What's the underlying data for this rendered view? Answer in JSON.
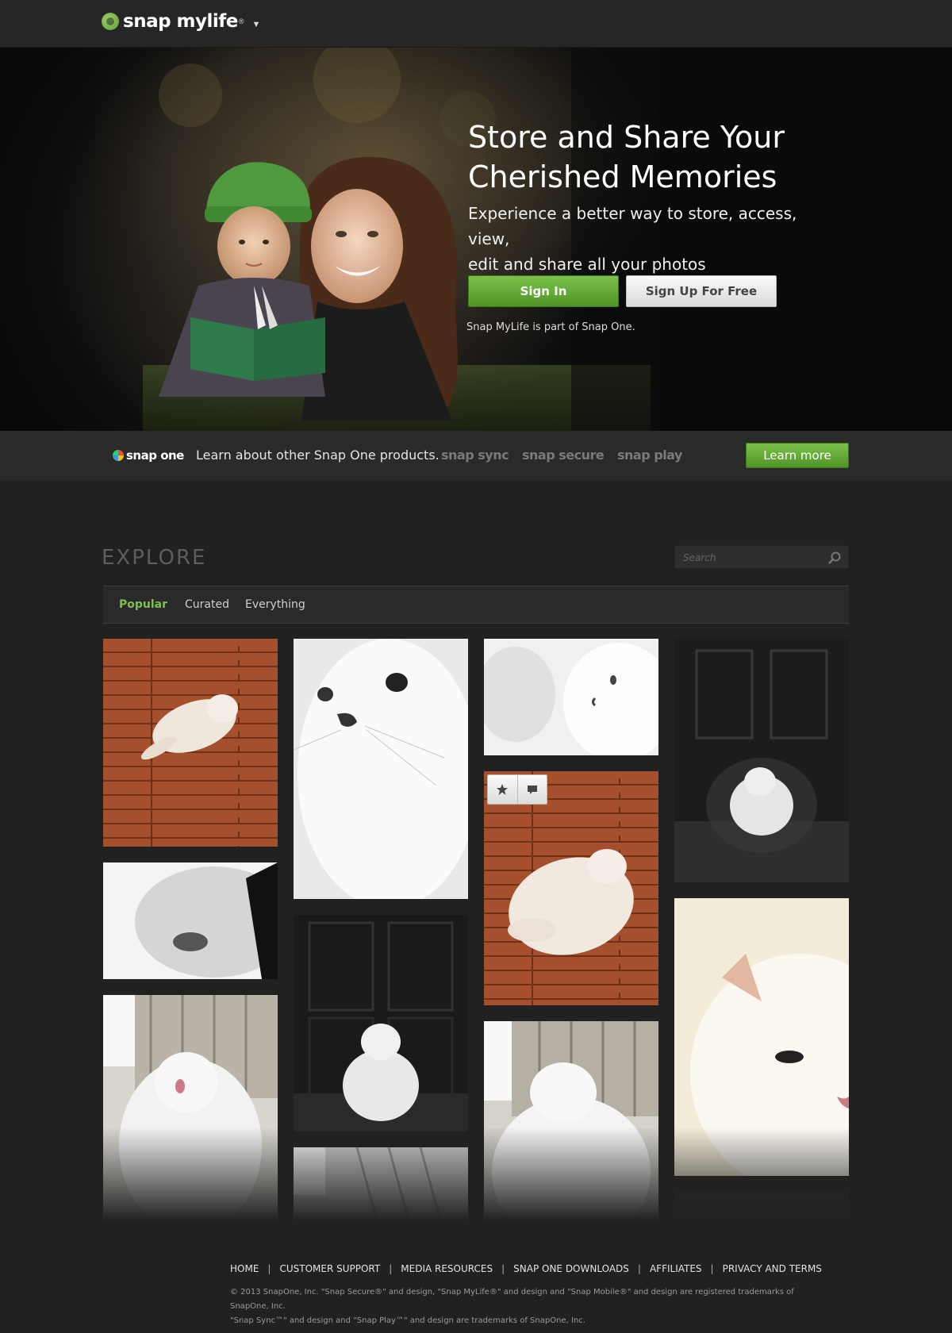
{
  "header": {
    "logo_text": "snap mylife",
    "logo_reg": "®",
    "menu_caret": "▼"
  },
  "hero": {
    "title_line1": "Store and Share Your",
    "title_line2": "Cherished Memories",
    "subtitle_line1": "Experience a better way to store, access, view,",
    "subtitle_line2": "edit and share all your photos",
    "signin_label": "Sign In",
    "signup_label": "Sign Up For Free",
    "note": "Snap MyLife is part of Snap One."
  },
  "snapone": {
    "logo_text": "snap one",
    "blurb": "Learn about other Snap One products.",
    "products": [
      "snap sync",
      "snap secure",
      "snap play"
    ],
    "learn_more_label": "Learn more"
  },
  "explore": {
    "title": "EXPLORE",
    "search_placeholder": "Search",
    "tabs": [
      {
        "label": "Popular",
        "active": true
      },
      {
        "label": "Curated",
        "active": false
      },
      {
        "label": "Everything",
        "active": false
      }
    ]
  },
  "footer": {
    "links": [
      "HOME",
      "CUSTOMER SUPPORT",
      "MEDIA RESOURCES",
      "SNAP ONE DOWNLOADS",
      "AFFILIATES",
      "PRIVACY AND TERMS"
    ],
    "separator": "|",
    "copyright_line1": "© 2013 SnapOne, Inc. \"Snap Secure®\" and design, \"Snap MyLife®\" and design and \"Snap Mobile®\" and design are registered trademarks of SnapOne, Inc.",
    "copyright_line2": "\"Snap Sync™\" and design and \"Snap Play™\" and design are trademarks of SnapOne, Inc."
  },
  "colors": {
    "accent_green": "#7cc14a",
    "page_bg": "#212121",
    "bar_bg": "#262626"
  }
}
